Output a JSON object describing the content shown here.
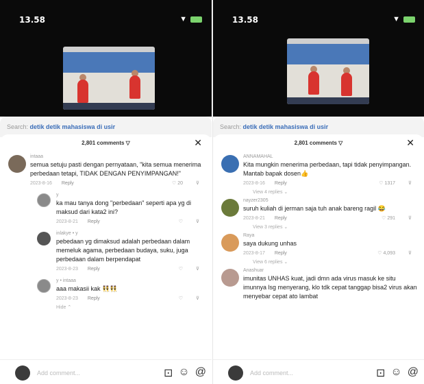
{
  "left": {
    "status": {
      "time": "13.58",
      "signal": "▾",
      "wifi": "▼"
    },
    "search": {
      "prefix": "Search:",
      "query": "detik detik mahasiswa di usir"
    },
    "comment_count": "2,801 comments ▽",
    "close_glyph": "✕",
    "comments": [
      {
        "user": "intaaa",
        "text": "semua setuju pasti dengan pernyataan, \"kita semua menerima perbedaan tetapi, TIDAK DENGAN PENYIMPANGAN!\"",
        "date": "2023-8-16",
        "reply": "Reply",
        "likes": "♡ 20"
      },
      {
        "user": "y",
        "text": "ka mau tanya dong \"perbedaan\" seperti apa yg di maksud dari kata2 ini?",
        "date": "2023-8-21",
        "reply": "Reply",
        "likes": "♡"
      },
      {
        "user": "inlakye • y",
        "text": "pebedaan yg dimaksud adalah perbedaan dalam memeluk agama, perbedaan budaya, suku, juga perbedaan dalam berpendapat",
        "date": "2023-8-23",
        "reply": "Reply",
        "likes": "♡"
      },
      {
        "user": "y • intaaa",
        "text": "aaa makasii kak 👯👯",
        "date": "2023-8-23",
        "reply": "Reply",
        "likes": "♡"
      }
    ],
    "hide": "Hide ⌃",
    "input_placeholder": "Add comment..."
  },
  "right": {
    "status": {
      "time": "13.58",
      "signal": "▾",
      "wifi": "▼"
    },
    "search": {
      "prefix": "Search:",
      "query": "detik detik mahasiswa di usir"
    },
    "comment_count": "2,801 comments ▽",
    "close_glyph": "✕",
    "comments": [
      {
        "user": "ANNAMAHAL",
        "text": "Kita mungkin menerima perbedaan, tapi tidak penyimpangan. Mantab bapak dosen👍",
        "date": "2023-8-16",
        "reply": "Reply",
        "likes": "♡ 1317",
        "view": "View 4 replies ⌄"
      },
      {
        "user": "nayzer2305",
        "text": "suruh kuliah di jerman saja tuh anak bareng ragil 😂",
        "date": "2023-8-21",
        "reply": "Reply",
        "likes": "♡ 291",
        "view": "View 3 replies ⌄"
      },
      {
        "user": "Raya",
        "text": "saya dukung unhas",
        "date": "2023-8-17",
        "reply": "Reply",
        "likes": "♡ 4,093",
        "view": "View 6 replies ⌄"
      },
      {
        "user": "Anashuar",
        "text": "imunitas UNHAS kuat, jadi dmn ada virus masuk ke situ imunnya lsg menyerang, klo tdk cepat tanggap bisa2 virus akan menyebar cepat ato lambat"
      }
    ],
    "input_placeholder": "Add comment..."
  },
  "icons": [
    "image-icon",
    "emoji-icon",
    "at-icon"
  ]
}
